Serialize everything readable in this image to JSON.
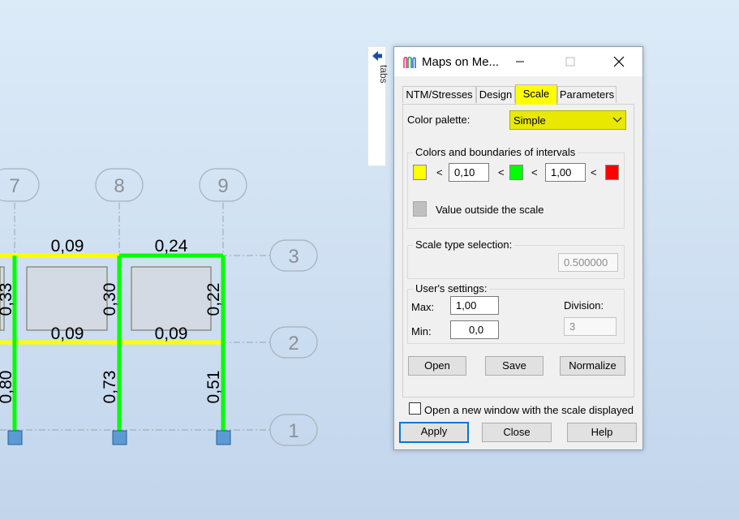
{
  "side_tab": {
    "label": "tabs"
  },
  "dialog": {
    "title": "Maps on Me...",
    "tabs": [
      {
        "label": "NTM/Stresses",
        "active": false
      },
      {
        "label": "Design",
        "active": false
      },
      {
        "label": "Scale",
        "active": true
      },
      {
        "label": "Parameters",
        "active": false
      }
    ],
    "color_palette": {
      "label": "Color palette:",
      "value": "Simple"
    },
    "intervals": {
      "title": "Colors and boundaries of intervals",
      "colors": [
        "#ffff00",
        "#00ff00",
        "#ff0000"
      ],
      "lt": "<",
      "bound1": "0,10",
      "bound2": "1,00",
      "outside_color": "#c0c0c0",
      "outside_label": "Value outside the scale"
    },
    "scale_type": {
      "title": "Scale type selection:",
      "value": "0.500000"
    },
    "user_settings": {
      "title": "User's settings:",
      "max_label": "Max:",
      "max_value": "1,00",
      "min_label": "Min:",
      "min_value": "0,0",
      "division_label": "Division:",
      "division_value": "3"
    },
    "buttons": {
      "open": "Open",
      "save": "Save",
      "normalize": "Normalize"
    },
    "checkbox": {
      "label": "Open a new window with the scale displayed",
      "checked": false
    },
    "footer": {
      "apply": "Apply",
      "close": "Close",
      "help": "Help"
    }
  },
  "model": {
    "axis_labels": [
      "7",
      "8",
      "9",
      "3",
      "2",
      "1"
    ],
    "values": {
      "top_beam_1": "0,09",
      "top_beam_2": "0,24",
      "col_upper_1": "0,33",
      "col_upper_2": "0,30",
      "col_upper_3": "0,22",
      "mid_beam_1": "0,09",
      "mid_beam_2": "0,09",
      "col_lower_1": "0,80",
      "col_lower_2": "0,73",
      "col_lower_3": "0,51"
    },
    "colors": {
      "low": "#ffff00",
      "mid": "#00ff00",
      "support": "#5b9bd5"
    }
  }
}
